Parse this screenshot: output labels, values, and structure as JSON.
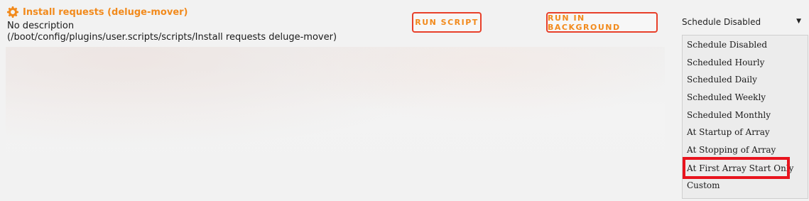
{
  "script": {
    "title": "Install requests (deluge-mover)",
    "description": "No description",
    "path": "(/boot/config/plugins/user.scripts/scripts/Install requests deluge-mover)",
    "icon": "gear-icon"
  },
  "buttons": {
    "run_script": "RUN SCRIPT",
    "run_background": "RUN IN BACKGROUND"
  },
  "schedule": {
    "selected": "Schedule Disabled",
    "options": [
      "Schedule Disabled",
      "Scheduled Hourly",
      "Scheduled Daily",
      "Scheduled Weekly",
      "Scheduled Monthly",
      "At Startup of Array",
      "At Stopping of Array",
      "At First Array Start Only",
      "Custom"
    ],
    "highlighted_option": "At First Array Start Only"
  },
  "colors": {
    "accent": "#f28a1c",
    "button_border": "#e8402a",
    "highlight_box": "#e8141e"
  }
}
